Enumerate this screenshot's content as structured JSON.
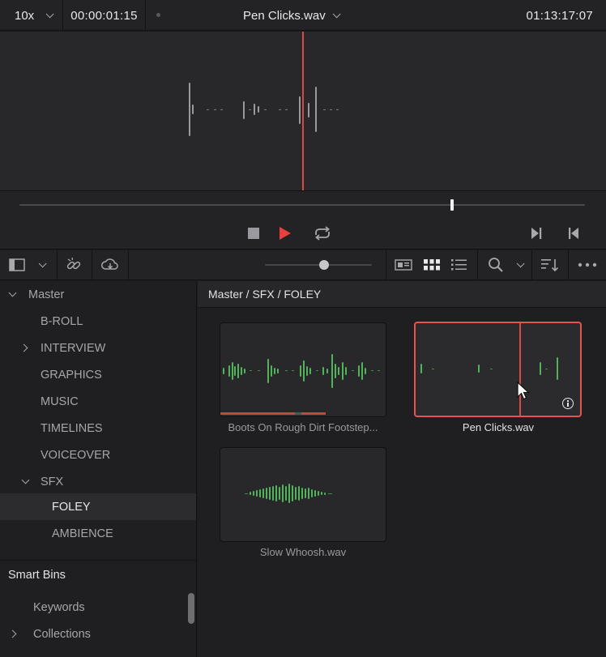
{
  "viewer": {
    "zoom": "10x",
    "timecode": "00:00:01:15",
    "clip_name": "Pen Clicks.wav",
    "duration": "01:13:17:07"
  },
  "transport": {
    "scrub_position": 0.765,
    "accent_color": "#e8403a"
  },
  "toolbar": {
    "icons": [
      "panel-toggle-icon",
      "chevron-down-icon",
      "unlink-icon",
      "cloud-sync-icon",
      "metadata-view-icon",
      "thumbnail-view-icon",
      "list-view-icon",
      "search-icon",
      "chevron-down-icon",
      "sort-icon",
      "more-icon"
    ],
    "thumbnail_size": 0.55
  },
  "sidebar": {
    "bins": [
      {
        "label": "Master",
        "arrow": "down"
      },
      {
        "label": "B-ROLL",
        "arrow": ""
      },
      {
        "label": "INTERVIEW",
        "arrow": "right"
      },
      {
        "label": "GRAPHICS",
        "arrow": ""
      },
      {
        "label": "MUSIC",
        "arrow": ""
      },
      {
        "label": "TIMELINES",
        "arrow": ""
      },
      {
        "label": "VOICEOVER",
        "arrow": ""
      },
      {
        "label": "SFX",
        "arrow": "down"
      },
      {
        "label": "FOLEY",
        "arrow": "",
        "selected": true
      },
      {
        "label": "AMBIENCE",
        "arrow": ""
      }
    ],
    "smart_bins_title": "Smart Bins",
    "smart_bins": [
      {
        "label": "Keywords",
        "arrow": ""
      },
      {
        "label": "Collections",
        "arrow": "right"
      }
    ]
  },
  "media_pool": {
    "breadcrumb": "Master / SFX / FOLEY",
    "clips": [
      {
        "name": "Boots On Rough Dirt Footstep...",
        "selected": false
      },
      {
        "name": "Pen Clicks.wav",
        "selected": true
      },
      {
        "name": "Slow Whoosh.wav",
        "selected": false
      }
    ],
    "selection_color": "#e5544e",
    "waveform_color": "#52b35b"
  }
}
